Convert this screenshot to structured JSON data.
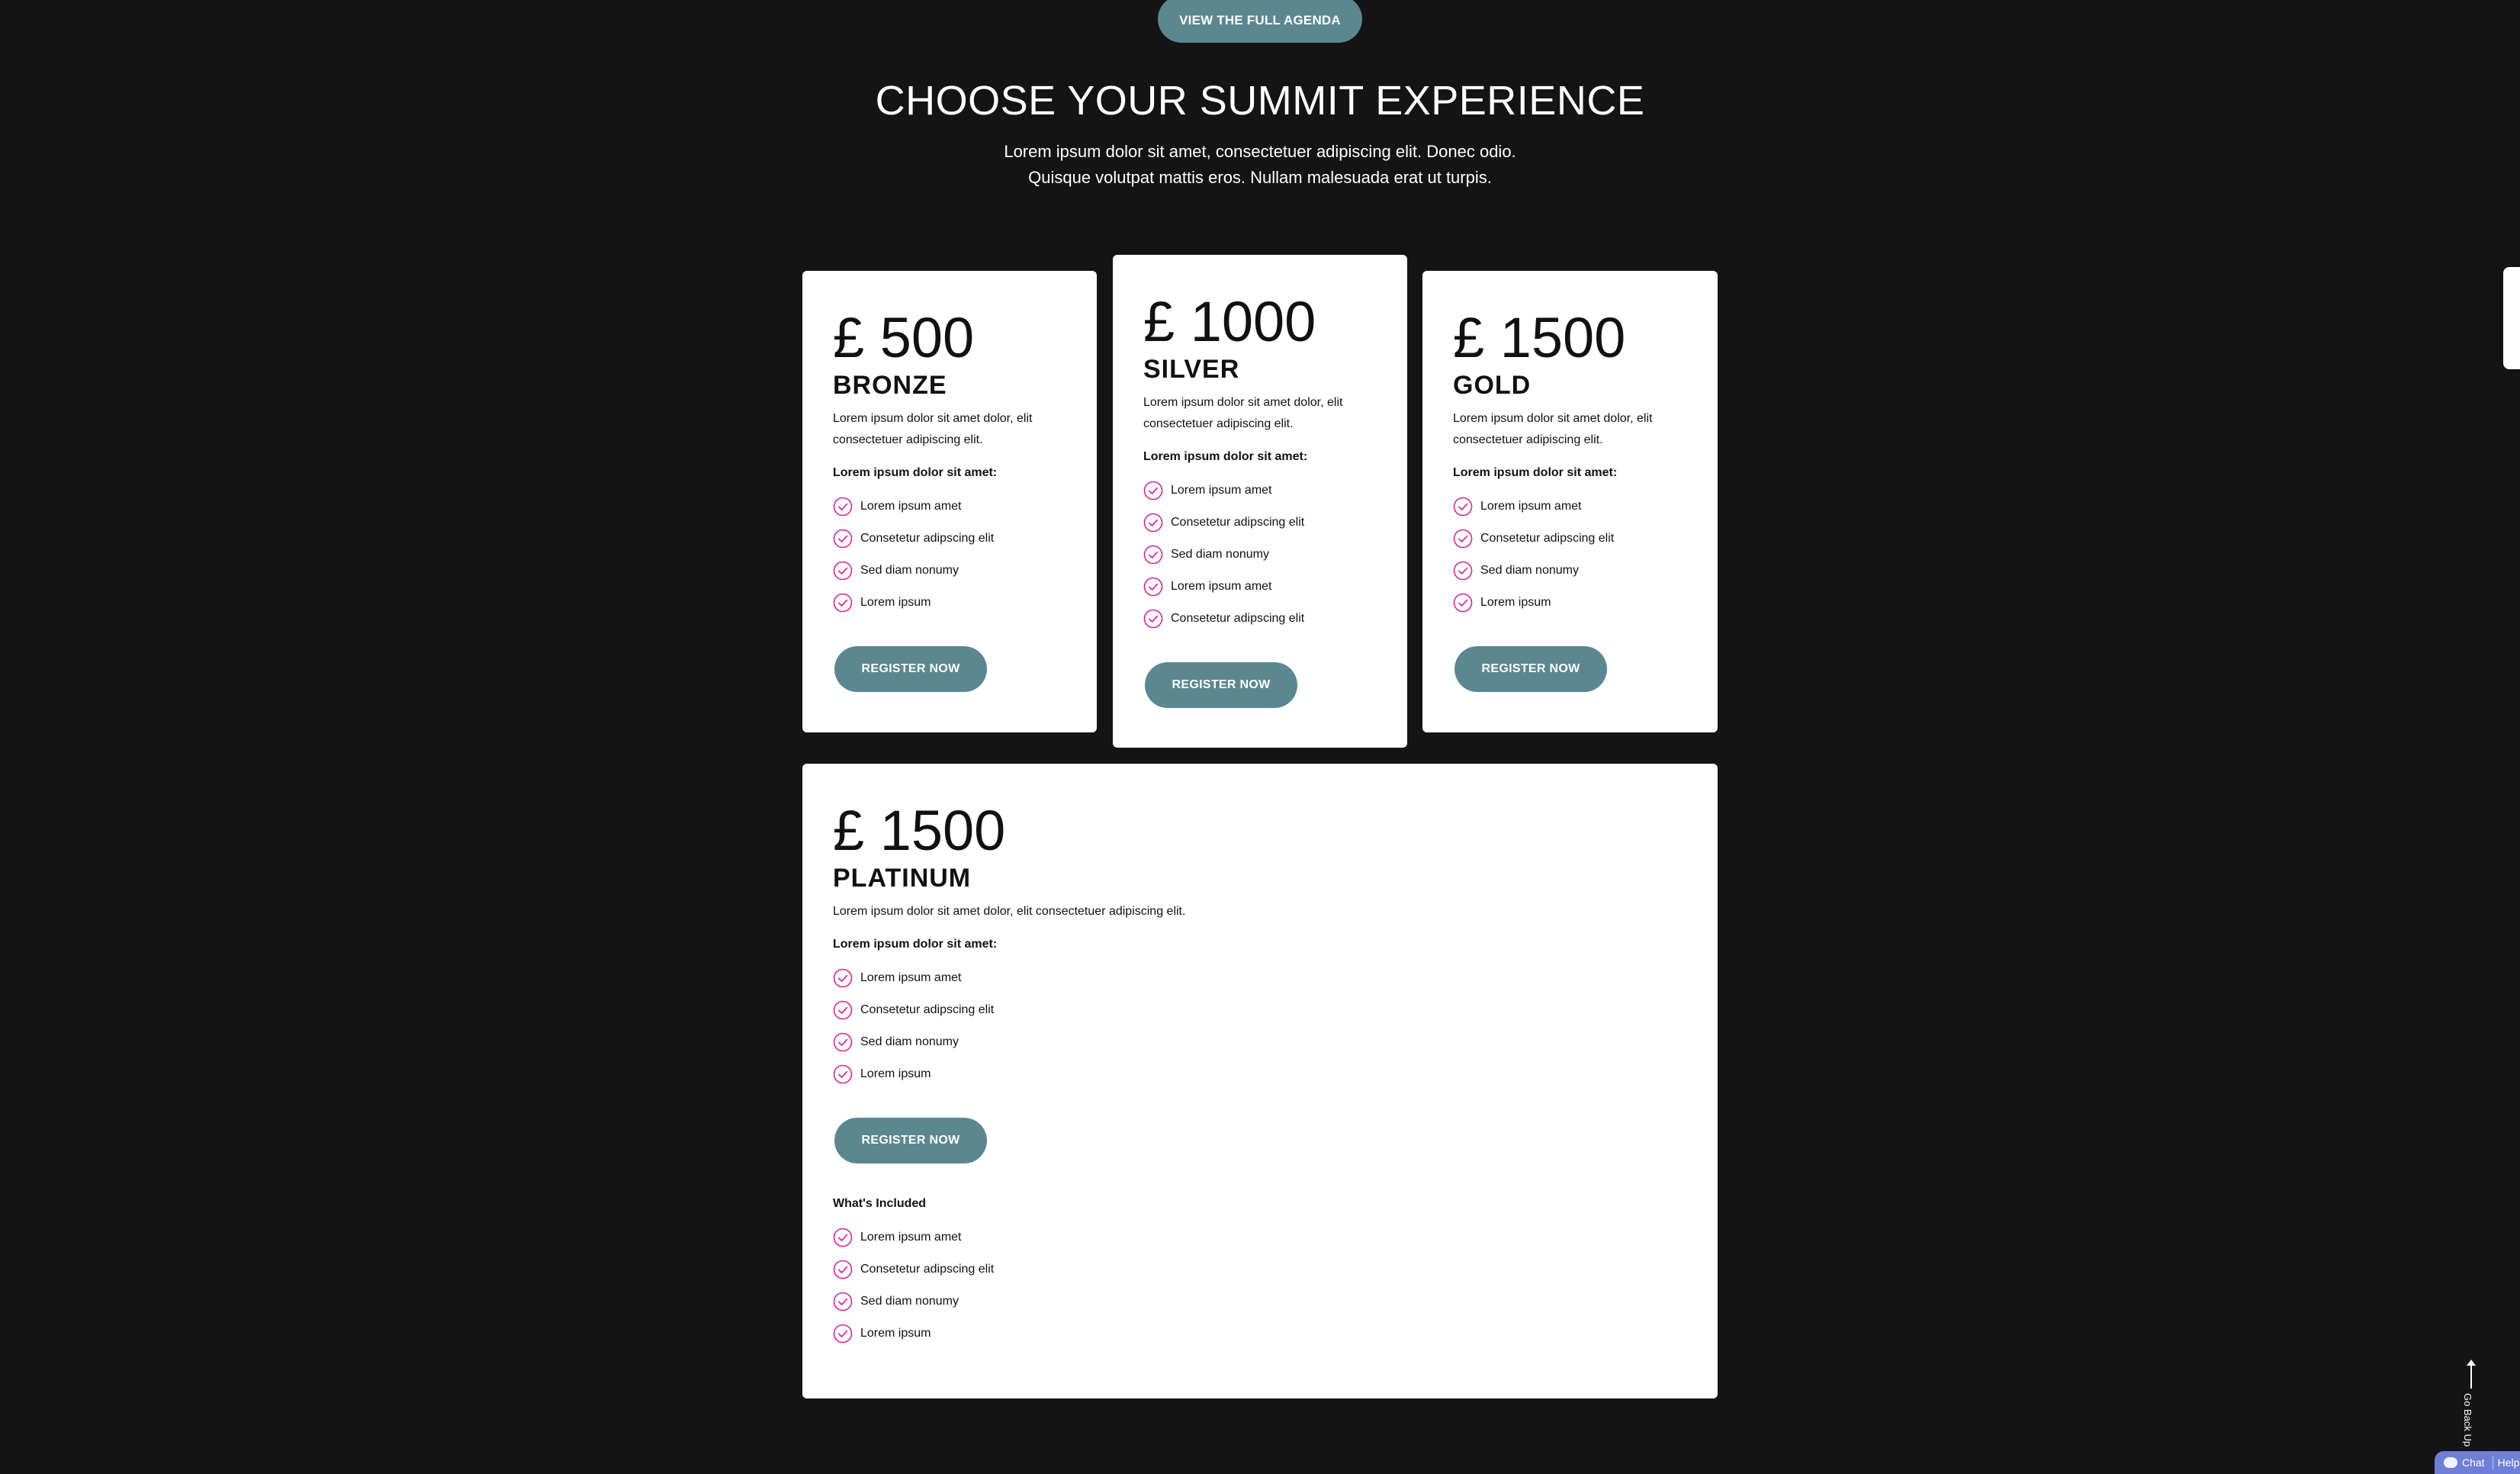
{
  "header": {
    "agenda_button": "VIEW THE FULL AGENDA",
    "title": "CHOOSE YOUR SUMMIT EXPERIENCE",
    "subtitle_line1": "Lorem ipsum dolor sit amet, consectetuer adipiscing elit. Donec odio.",
    "subtitle_line2": "Quisque volutpat mattis eros. Nullam malesuada erat ut turpis."
  },
  "plans": {
    "bronze": {
      "price": "£ 500",
      "name": "BRONZE",
      "description": "Lorem ipsum dolor sit amet dolor, elit consectetuer adipiscing elit.",
      "subheading": "Lorem ipsum dolor sit amet:",
      "features": [
        "Lorem ipsum amet",
        "Consetetur adipscing elit",
        "Sed diam nonumy",
        "Lorem ipsum"
      ],
      "cta": "REGISTER NOW"
    },
    "silver": {
      "price": "£ 1000",
      "name": "SILVER",
      "description": "Lorem ipsum dolor sit amet dolor, elit consectetuer adipiscing elit.",
      "subheading": "Lorem ipsum dolor sit amet:",
      "features": [
        "Lorem ipsum amet",
        "Consetetur adipscing elit",
        "Sed diam nonumy",
        "Lorem ipsum amet",
        "Consetetur adipscing elit"
      ],
      "cta": "REGISTER NOW"
    },
    "gold": {
      "price": "£ 1500",
      "name": "GOLD",
      "description": "Lorem ipsum dolor sit amet dolor, elit consectetuer adipiscing elit.",
      "subheading": "Lorem ipsum dolor sit amet:",
      "features": [
        "Lorem ipsum amet",
        "Consetetur adipscing elit",
        "Sed diam nonumy",
        "Lorem ipsum"
      ],
      "cta": "REGISTER NOW"
    },
    "platinum": {
      "price": "£ 1500",
      "name": "PLATINUM",
      "description": "Lorem ipsum dolor sit amet dolor, elit consectetuer adipiscing elit.",
      "subheading": "Lorem ipsum dolor sit amet:",
      "features": [
        "Lorem ipsum amet",
        "Consetetur adipscing elit",
        "Sed diam nonumy",
        "Lorem ipsum"
      ],
      "cta": "REGISTER NOW",
      "included_title": "What's Included",
      "included": [
        "Lorem ipsum amet",
        "Consetetur adipscing elit",
        "Sed diam nonumy",
        "Lorem ipsum"
      ]
    }
  },
  "widgets": {
    "go_back_label": "Go Back Up",
    "chat_label": "Chat",
    "help_label": "Help"
  },
  "icons": {
    "check": "check-circle-icon",
    "chat": "chat-bubble-icon",
    "go_back": "arrow-up-icon"
  },
  "colors": {
    "background": "#141414",
    "button": "#5b8791",
    "check": "#d4279b",
    "chat_bar": "#6f7fd6"
  }
}
